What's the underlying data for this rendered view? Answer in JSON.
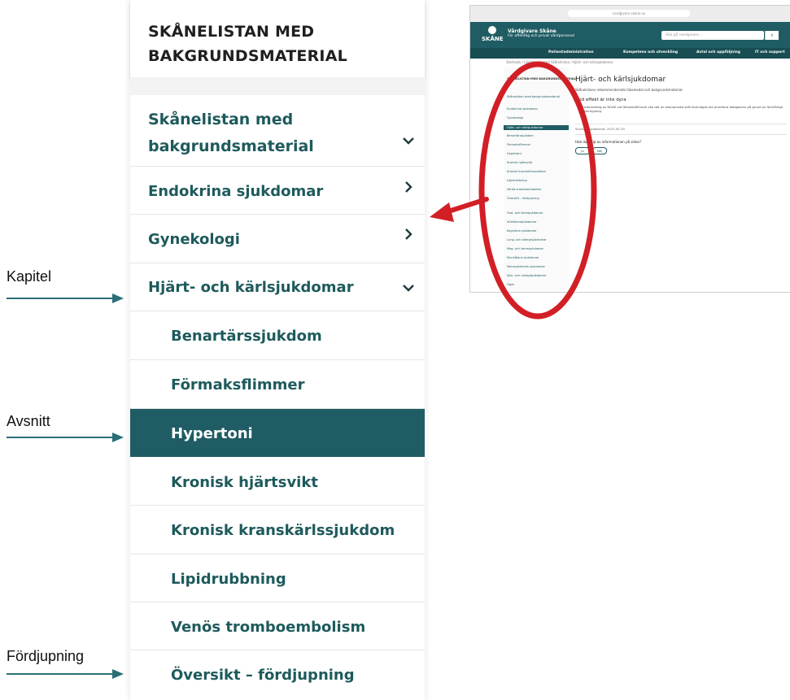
{
  "panel": {
    "header": "SKÅNELISTAN MED BAKGRUNDSMATERIAL",
    "items": [
      {
        "label": "Skånelistan med bakgrundsmaterial",
        "chevron": "chevron-down"
      },
      {
        "label": "Endokrina sjukdomar",
        "chevron": "chevron-right"
      },
      {
        "label": "Gynekologi",
        "chevron": "chevron-right"
      },
      {
        "label": "Hjärt- och kärlsjukdomar",
        "chevron": "chevron-down"
      },
      {
        "label": "Benartärssjukdom"
      },
      {
        "label": "Förmaksflimmer"
      },
      {
        "label": "Hypertoni",
        "active": true
      },
      {
        "label": "Kronisk hjärtsvikt"
      },
      {
        "label": "Kronisk kranskärlssjukdom"
      },
      {
        "label": "Lipidrubbning"
      },
      {
        "label": "Venös tromboembolism"
      },
      {
        "label": "Översikt – fördjupning"
      }
    ]
  },
  "annotations": {
    "kapitel": "Kapitel",
    "avsnitt": "Avsnitt",
    "fordjupning": "Fördjupning"
  },
  "thumbnail": {
    "url": "vardgivare.skane.se",
    "logo": "SKÅNE",
    "site_title": "Vårdgivare Skåne",
    "site_subtitle": "För offentlig och privat vårdpersonal",
    "search_placeholder": "Sök på vardgivare...",
    "search_icon": "search-icon",
    "menu": [
      "Patientadministration",
      "Kompetens och utveckling",
      "Avtal och uppföljning",
      "IT och support"
    ],
    "breadcrumb": "Startsida / Läkemedel med Skånelistan / Hjärt- och kärlsjukdomar",
    "heading": "Hjärt- och kärlsjukdomar",
    "intro": "Skånelistans rekommenderade läkemedel och bakgrundsmaterial.",
    "subheading": "God effekt är inte dyra",
    "text": "Vid behandling av NOAK vid förmaksflimmer ska det av ekonomiska skäl övervägas att prioritera ibdagatran på grund av förmånligt pristerungning.",
    "date": "Senast uppdaterad: 2023-05-29",
    "question": "Hob du hjälp av informationen på sidan?",
    "yes": "Ja",
    "no": "Nej",
    "side_items": [
      "SKÅNELISTAN MED BAKGRUNDSMATERIAL",
      "Skånelistan med bakgrundsmaterial",
      "Endokrina sjukdomar",
      "Gynekologi",
      "Hjärt- och kärlsjukdomar",
      "Benartärssjukdom",
      "Förmaksflimmer",
      "Hypertoni",
      "Kronisk hjärtsvikt",
      "Kronisk kranskärlssjukdom",
      "Lipidrubbning",
      "Venös tromboembolism",
      "Översikt – fördjupning",
      "Hud- och könssjukdomar",
      "Infektionssjukdomar",
      "Kognitiva sjukdomar",
      "Lung- och allergisjukdomar",
      "Mag- och tarmsjukdomar",
      "Munhålans sjukdomar",
      "Nervsystemets sjukdomar",
      "Njur- och urologisjukdomar",
      "Ögon"
    ]
  },
  "colors": {
    "teal": "#1f5c63",
    "text_teal": "#1e5a5c",
    "red": "#d21f26"
  }
}
